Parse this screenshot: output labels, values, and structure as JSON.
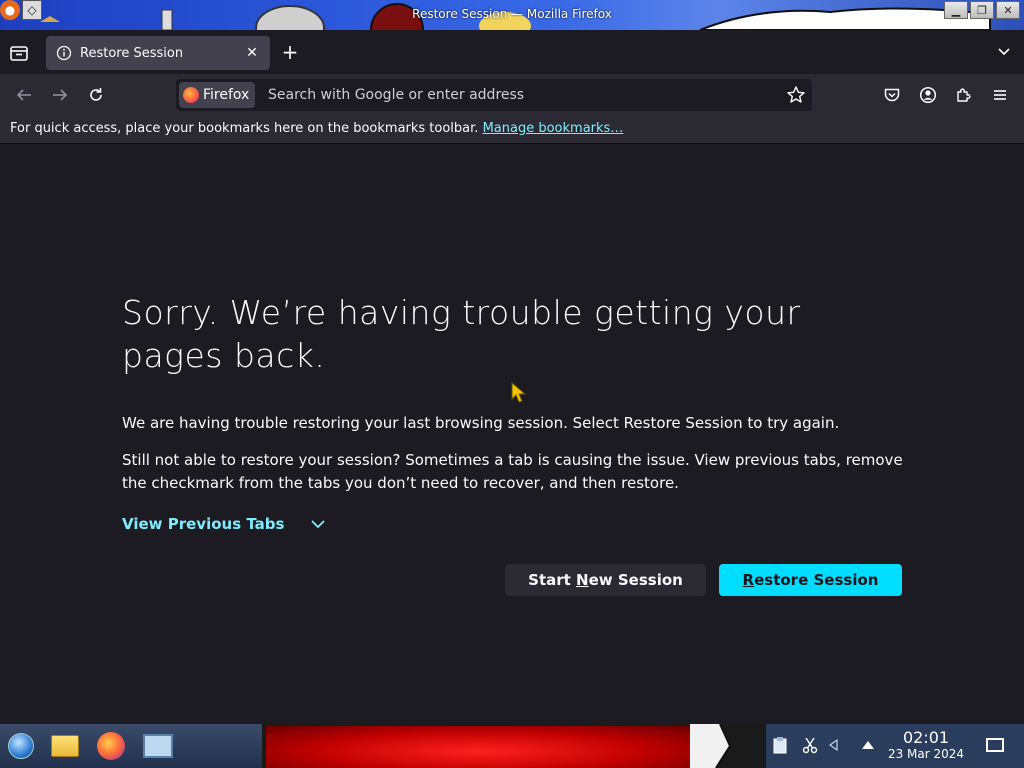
{
  "window": {
    "title": "Restore Session — Mozilla Firefox",
    "controls": {
      "minimize": "▁",
      "restore": "❐",
      "close": "✕"
    }
  },
  "tabs": [
    {
      "label": "Restore Session",
      "icon": "info-icon",
      "active": true
    }
  ],
  "navbar": {
    "identity_label": "Firefox",
    "url_placeholder": "Search with Google or enter address",
    "url_value": ""
  },
  "bookmarks_bar": {
    "message": "For quick access, place your bookmarks here on the bookmarks toolbar.",
    "link": "Manage bookmarks…"
  },
  "page": {
    "headline": "Sorry. We’re having trouble getting your pages back.",
    "para1": "We are having trouble restoring your last browsing session. Select Restore Session to try again.",
    "para2": "Still not able to restore your session? Sometimes a tab is causing the issue. View previous tabs, remove the checkmark from the tabs you don’t need to recover, and then restore.",
    "view_previous": "View Previous Tabs",
    "btn_new_pre": "Start ",
    "btn_new_key": "N",
    "btn_new_post": "ew Session",
    "btn_restore_key": "R",
    "btn_restore_post": "estore Session"
  },
  "taskbar": {
    "time": "02:01",
    "date": "23 Mar 2024"
  },
  "colors": {
    "accent": "#00ddff",
    "link": "#80ebff",
    "background": "#1c1b22",
    "toolbar": "#2b2a33"
  }
}
